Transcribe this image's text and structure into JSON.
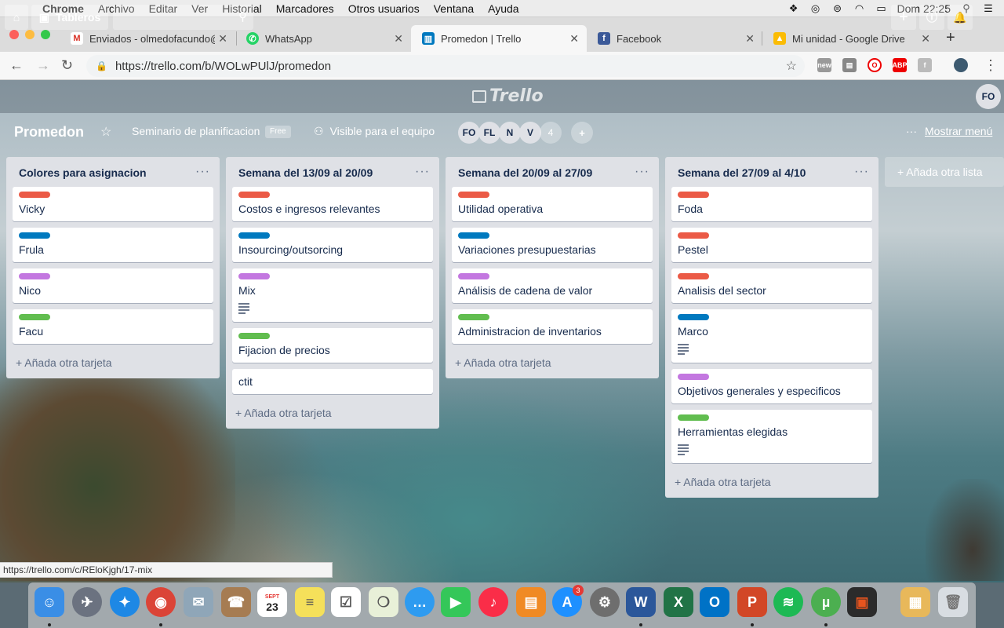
{
  "menubar": {
    "app": "Chrome",
    "items": [
      "Archivo",
      "Editar",
      "Ver",
      "Historial",
      "Marcadores",
      "Otros usuarios",
      "Ventana",
      "Ayuda"
    ],
    "clock": "Dom 22:25"
  },
  "tabs": [
    {
      "label": "Enviados - olmedofacundo@",
      "icon": "gmail-icon",
      "color": "#d93025"
    },
    {
      "label": "WhatsApp",
      "icon": "whatsapp-icon",
      "color": "#25d366"
    },
    {
      "label": "Promedon | Trello",
      "icon": "trello-icon",
      "color": "#0079bf",
      "active": true
    },
    {
      "label": "Facebook",
      "icon": "facebook-icon",
      "color": "#3b5998"
    },
    {
      "label": "Mi unidad - Google Drive",
      "icon": "google-drive-icon",
      "color": "#fbbc04"
    }
  ],
  "address": {
    "url": "https://trello.com/b/WOLwPUlJ/promedon"
  },
  "trello_header": {
    "boards_label": "Tableros",
    "logo": "Trello",
    "user_initials": "FO"
  },
  "board": {
    "title": "Promedon",
    "team": "Seminario de planificacion",
    "free_badge": "Free",
    "visibility": "Visible para el equipo",
    "members": [
      "FO",
      "FL",
      "N",
      "V"
    ],
    "member_count": "4",
    "show_menu": "Mostrar menú",
    "add_list": "+ Añada otra lista"
  },
  "label_colors": {
    "red": "#eb5a46",
    "blue": "#0079bf",
    "purple": "#c377e0",
    "green": "#61bd4f"
  },
  "lists": [
    {
      "title": "Colores para asignacion",
      "cards": [
        {
          "title": "Vicky",
          "label": "#eb5a46"
        },
        {
          "title": "Frula",
          "label": "#0079bf"
        },
        {
          "title": "Nico",
          "label": "#c377e0"
        },
        {
          "title": "Facu",
          "label": "#61bd4f"
        }
      ],
      "add_card": "+ Añada otra tarjeta"
    },
    {
      "title": "Semana del 13/09 al 20/09",
      "cards": [
        {
          "title": "Costos e ingresos relevantes",
          "label": "#eb5a46"
        },
        {
          "title": "Insourcing/outsorcing",
          "label": "#0079bf"
        },
        {
          "title": "Mix",
          "label": "#c377e0",
          "description": true
        },
        {
          "title": "Fijacion de precios",
          "label": "#61bd4f"
        },
        {
          "title": "ctit",
          "label": ""
        }
      ],
      "add_card": "+ Añada otra tarjeta"
    },
    {
      "title": "Semana del 20/09 al 27/09",
      "cards": [
        {
          "title": "Utilidad operativa",
          "label": "#eb5a46"
        },
        {
          "title": "Variaciones presupuestarias",
          "label": "#0079bf"
        },
        {
          "title": "Análisis de cadena de valor",
          "label": "#c377e0"
        },
        {
          "title": "Administracion de inventarios",
          "label": "#61bd4f"
        }
      ],
      "add_card": "+ Añada otra tarjeta"
    },
    {
      "title": "Semana del 27/09 al 4/10",
      "cards": [
        {
          "title": "Foda",
          "label": "#eb5a46"
        },
        {
          "title": "Pestel",
          "label": "#eb5a46"
        },
        {
          "title": "Analisis del sector",
          "label": "#eb5a46"
        },
        {
          "title": "Marco",
          "label": "#0079bf",
          "description": true
        },
        {
          "title": "Objetivos generales y especificos",
          "label": "#c377e0"
        },
        {
          "title": "Herramientas elegidas",
          "label": "#61bd4f",
          "description": true
        }
      ],
      "add_card": "+ Añada otra tarjeta"
    }
  ],
  "status_bar": "https://trello.com/c/REloKjgh/17-mix",
  "dock": {
    "calendar_month": "SEPT",
    "calendar_day": "23",
    "appstore_badge": "3"
  }
}
